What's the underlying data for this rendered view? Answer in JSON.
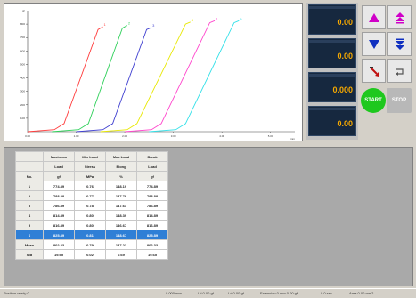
{
  "chart": {
    "curve_labels": [
      "1",
      "2",
      "3",
      "4",
      "5",
      "6"
    ],
    "x_ticks": [
      "0.00",
      "1.00",
      "2.00",
      "3.00",
      "4.00",
      "5.00"
    ],
    "y_ticks": [
      "100",
      "200",
      "300",
      "400",
      "500",
      "600",
      "700",
      "800"
    ],
    "x_title": "mm",
    "y_title": "gf"
  },
  "chart_data": {
    "type": "line",
    "title": "",
    "xlabel": "mm",
    "ylabel": "gf",
    "xlim": [
      0,
      5.5
    ],
    "ylim": [
      0,
      900
    ],
    "grid": false,
    "series": [
      {
        "name": "1",
        "color": "#ff3b3b",
        "x": [
          0.0,
          0.55,
          0.75,
          1.45,
          1.55
        ],
        "y": [
          0,
          15,
          60,
          760,
          780
        ]
      },
      {
        "name": "2",
        "color": "#2fd05a",
        "x": [
          0.5,
          1.05,
          1.25,
          1.95,
          2.05
        ],
        "y": [
          0,
          15,
          60,
          770,
          790
        ]
      },
      {
        "name": "3",
        "color": "#3f3fd0",
        "x": [
          1.0,
          1.55,
          1.75,
          2.45,
          2.55
        ],
        "y": [
          0,
          15,
          60,
          760,
          775
        ]
      },
      {
        "name": "4",
        "color": "#e8e800",
        "x": [
          1.5,
          2.05,
          2.25,
          3.25,
          3.35
        ],
        "y": [
          0,
          15,
          60,
          800,
          815
        ]
      },
      {
        "name": "5",
        "color": "#ff44cc",
        "x": [
          2.0,
          2.55,
          2.75,
          3.75,
          3.85
        ],
        "y": [
          0,
          15,
          60,
          810,
          825
        ]
      },
      {
        "name": "6",
        "color": "#33e0e8",
        "x": [
          2.5,
          3.05,
          3.25,
          4.25,
          4.35
        ],
        "y": [
          0,
          15,
          60,
          810,
          825
        ]
      }
    ]
  },
  "readouts": [
    {
      "value": "0.00"
    },
    {
      "value": "0.00"
    },
    {
      "value": "0.000"
    },
    {
      "value": "0.00"
    }
  ],
  "controls": {
    "start_label": "START",
    "stop_label": "STOP",
    "colors": {
      "magenta": "#d000c8",
      "blue": "#1030c0",
      "green": "#1ec81e",
      "stop_gray": "#b8b8b8"
    }
  },
  "table": {
    "header_row1": [
      "Maximum",
      "Min Load",
      "Max Load",
      "Break"
    ],
    "header_row2": [
      "Load",
      "Stress",
      "Elong",
      "Load"
    ],
    "unit_row_label": "No.",
    "unit_row": [
      "gf",
      "MPa",
      "%",
      "gf"
    ],
    "rows": [
      {
        "no": "1",
        "cells": [
          "774.89",
          "0.76",
          "148.19",
          "774.89"
        ]
      },
      {
        "no": "2",
        "cells": [
          "788.88",
          "0.77",
          "147.79",
          "788.88"
        ]
      },
      {
        "no": "3",
        "cells": [
          "786.89",
          "0.78",
          "147.63",
          "786.89"
        ]
      },
      {
        "no": "4",
        "cells": [
          "814.89",
          "0.80",
          "148.39",
          "814.89"
        ]
      },
      {
        "no": "5",
        "cells": [
          "816.89",
          "0.80",
          "146.67",
          "816.89"
        ]
      },
      {
        "no": "6",
        "cells": [
          "825.89",
          "0.81",
          "148.67",
          "825.89"
        ]
      }
    ],
    "mean": {
      "label": "Mean",
      "cells": [
        "802.33",
        "0.79",
        "147.21",
        "802.33"
      ]
    },
    "std": {
      "label": "Std",
      "cells": [
        "19.65",
        "0.02",
        "0.69",
        "19.65"
      ]
    }
  },
  "status": {
    "left": "Position ready 0",
    "segments": [
      "0.000 mm",
      "Ld 0.00 gf",
      "Ld 0.00 gf",
      "Extension 0 mm 0.00 gf",
      "0.0 sec",
      "Area 0.00 mm2"
    ]
  }
}
